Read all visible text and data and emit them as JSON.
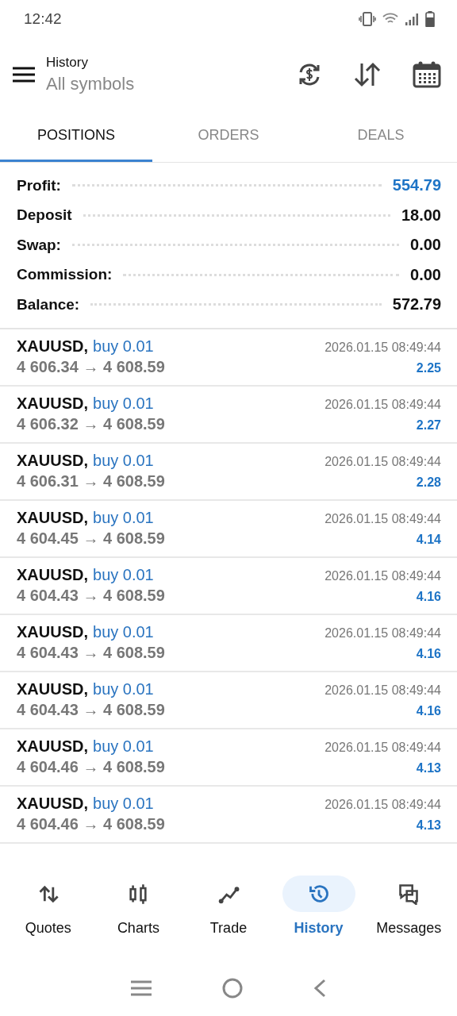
{
  "status_bar": {
    "time": "12:42"
  },
  "header": {
    "title": "History",
    "subtitle": "All symbols"
  },
  "tabs": [
    {
      "label": "POSITIONS",
      "selected": true
    },
    {
      "label": "ORDERS",
      "selected": false
    },
    {
      "label": "DEALS",
      "selected": false
    }
  ],
  "summary": [
    {
      "label": "Profit:",
      "value": "554.79",
      "color": "#1e74c6"
    },
    {
      "label": "Deposit",
      "value": "18.00",
      "color": "#111111"
    },
    {
      "label": "Swap:",
      "value": "0.00",
      "color": "#111111"
    },
    {
      "label": "Commission:",
      "value": "0.00",
      "color": "#111111"
    },
    {
      "label": "Balance:",
      "value": "572.79",
      "color": "#111111"
    }
  ],
  "positions": [
    {
      "symbol": "XAUUSD,",
      "type": "buy 0.01",
      "prices": "4 606.34 → 4 608.59",
      "time": "2026.01.15 08:49:44",
      "profit": "2.25"
    },
    {
      "symbol": "XAUUSD,",
      "type": "buy 0.01",
      "prices": "4 606.32 → 4 608.59",
      "time": "2026.01.15 08:49:44",
      "profit": "2.27"
    },
    {
      "symbol": "XAUUSD,",
      "type": "buy 0.01",
      "prices": "4 606.31 → 4 608.59",
      "time": "2026.01.15 08:49:44",
      "profit": "2.28"
    },
    {
      "symbol": "XAUUSD,",
      "type": "buy 0.01",
      "prices": "4 604.45 → 4 608.59",
      "time": "2026.01.15 08:49:44",
      "profit": "4.14"
    },
    {
      "symbol": "XAUUSD,",
      "type": "buy 0.01",
      "prices": "4 604.43 → 4 608.59",
      "time": "2026.01.15 08:49:44",
      "profit": "4.16"
    },
    {
      "symbol": "XAUUSD,",
      "type": "buy 0.01",
      "prices": "4 604.43 → 4 608.59",
      "time": "2026.01.15 08:49:44",
      "profit": "4.16"
    },
    {
      "symbol": "XAUUSD,",
      "type": "buy 0.01",
      "prices": "4 604.43 → 4 608.59",
      "time": "2026.01.15 08:49:44",
      "profit": "4.16"
    },
    {
      "symbol": "XAUUSD,",
      "type": "buy 0.01",
      "prices": "4 604.46 → 4 608.59",
      "time": "2026.01.15 08:49:44",
      "profit": "4.13"
    },
    {
      "symbol": "XAUUSD,",
      "type": "buy 0.01",
      "prices": "4 604.46 → 4 608.59",
      "time": "2026.01.15 08:49:44",
      "profit": "4.13"
    }
  ],
  "bottom_nav": [
    {
      "label": "Quotes",
      "selected": false
    },
    {
      "label": "Charts",
      "selected": false
    },
    {
      "label": "Trade",
      "selected": false
    },
    {
      "label": "History",
      "selected": true
    },
    {
      "label": "Messages",
      "selected": false
    }
  ]
}
